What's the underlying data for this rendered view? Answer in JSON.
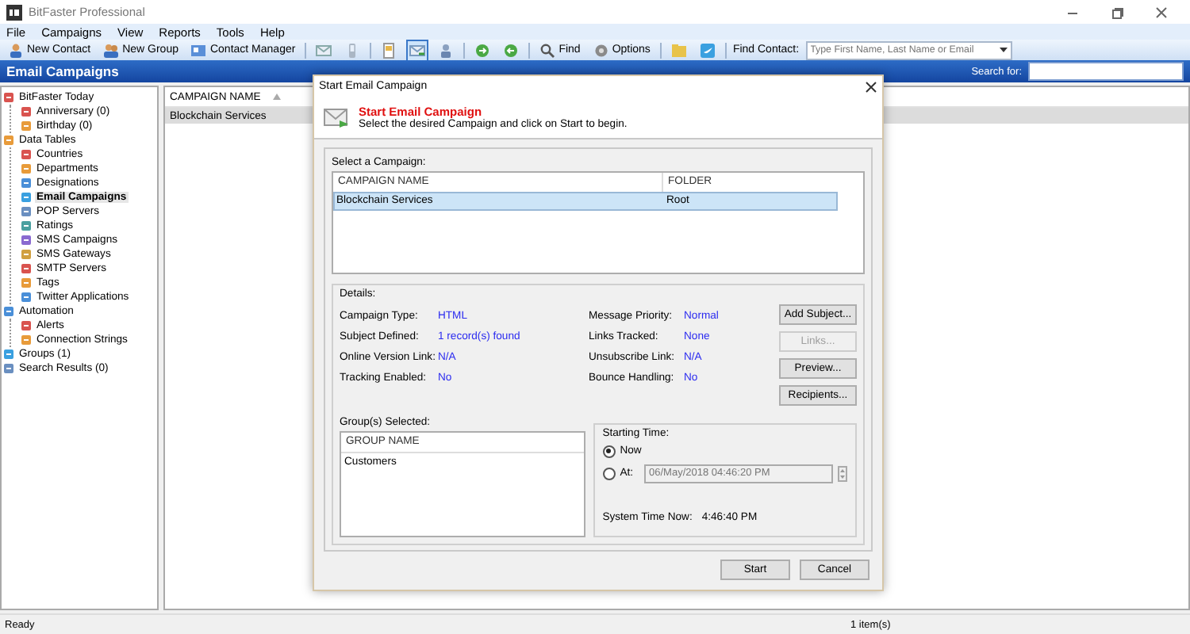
{
  "window": {
    "title": "BitFaster Professional"
  },
  "menu": [
    "File",
    "Campaigns",
    "View",
    "Reports",
    "Tools",
    "Help"
  ],
  "toolbar": [
    {
      "kind": "button",
      "label": "New Contact"
    },
    {
      "kind": "button",
      "label": "New Group"
    },
    {
      "kind": "button",
      "label": "Contact Manager"
    },
    {
      "kind": "separator"
    },
    {
      "kind": "icon",
      "pressed": false
    },
    {
      "kind": "icon",
      "pressed": false
    },
    {
      "kind": "separator"
    },
    {
      "kind": "icon",
      "pressed": false
    },
    {
      "kind": "icon",
      "pressed": true
    },
    {
      "kind": "icon",
      "pressed": false
    },
    {
      "kind": "separator"
    },
    {
      "kind": "icon",
      "pressed": false
    },
    {
      "kind": "icon",
      "pressed": false
    },
    {
      "kind": "separator"
    },
    {
      "kind": "button",
      "label": "Find"
    },
    {
      "kind": "button",
      "label": "Options"
    },
    {
      "kind": "separator"
    },
    {
      "kind": "icon",
      "pressed": false
    },
    {
      "kind": "icon",
      "pressed": false
    },
    {
      "kind": "separator"
    }
  ],
  "find_contact": {
    "label": "Find Contact:",
    "placeholder": "Type First Name, Last Name or Email"
  },
  "header": {
    "title": "Email Campaigns",
    "search_label": "Search for:"
  },
  "sidebar": {
    "items": [
      {
        "label": "BitFaster Today",
        "selected": false,
        "children": [
          {
            "label": "Anniversary (0)",
            "selected": false
          },
          {
            "label": "Birthday (0)",
            "selected": false
          }
        ]
      },
      {
        "label": "Data Tables",
        "selected": false,
        "children": [
          {
            "label": "Countries",
            "selected": false
          },
          {
            "label": "Departments",
            "selected": false
          },
          {
            "label": "Designations",
            "selected": false
          },
          {
            "label": "Email Campaigns",
            "selected": true
          },
          {
            "label": "POP Servers",
            "selected": false
          },
          {
            "label": "Ratings",
            "selected": false
          },
          {
            "label": "SMS Campaigns",
            "selected": false
          },
          {
            "label": "SMS Gateways",
            "selected": false
          },
          {
            "label": "SMTP Servers",
            "selected": false
          },
          {
            "label": "Tags",
            "selected": false
          },
          {
            "label": "Twitter Applications",
            "selected": false
          }
        ]
      },
      {
        "label": "Automation",
        "selected": false,
        "children": [
          {
            "label": "Alerts",
            "selected": false
          },
          {
            "label": "Connection Strings",
            "selected": false
          }
        ]
      },
      {
        "label": "Groups (1)",
        "selected": false
      },
      {
        "label": "Search Results (0)",
        "selected": false
      }
    ]
  },
  "list": {
    "columns": [
      "CAMPAIGN NAME"
    ],
    "rows": [
      {
        "cells": [
          "Blockchain Services"
        ],
        "selected": true
      }
    ]
  },
  "dialog": {
    "title": "Start Email Campaign",
    "heading": "Start Email Campaign",
    "subheading": "Select the desired Campaign and click on Start to begin.",
    "campaign_label": "Select a Campaign:",
    "columns": [
      "CAMPAIGN NAME",
      "FOLDER"
    ],
    "rows": [
      {
        "cells": [
          "Blockchain Services",
          "Root"
        ],
        "selected": true
      }
    ],
    "details_label": "Details:",
    "details": [
      {
        "label": "Campaign Type:",
        "value": "HTML"
      },
      {
        "label": "Message Priority:",
        "value": "Normal"
      },
      {
        "label": "Subject Defined:",
        "value": "1 record(s) found"
      },
      {
        "label": "Links Tracked:",
        "value": "None"
      },
      {
        "label": "Online Version Link:",
        "value": "N/A"
      },
      {
        "label": "Unsubscribe Link:",
        "value": "N/A"
      },
      {
        "label": "Tracking Enabled:",
        "value": "No"
      },
      {
        "label": "Bounce Handling:",
        "value": "No"
      }
    ],
    "side_buttons": [
      {
        "label": "Add Subject...",
        "disabled": false
      },
      {
        "label": "Links...",
        "disabled": true
      },
      {
        "label": "Preview...",
        "disabled": false
      },
      {
        "label": "Recipients...",
        "disabled": false
      }
    ],
    "groups_label": "Group(s) Selected:",
    "group_column": "GROUP NAME",
    "groups": [
      "Customers"
    ],
    "starting_label": "Starting Time:",
    "options": [
      {
        "label": "Now",
        "selected": true
      },
      {
        "label": "At:",
        "selected": false
      }
    ],
    "datetime": "06/May/2018 04:46:20 PM",
    "system_time_label": "System Time Now:",
    "system_time": "4:46:40 PM",
    "buttons": [
      "Start",
      "Cancel"
    ]
  },
  "status_bar": {
    "left": "Ready",
    "right": "1 item(s)"
  }
}
